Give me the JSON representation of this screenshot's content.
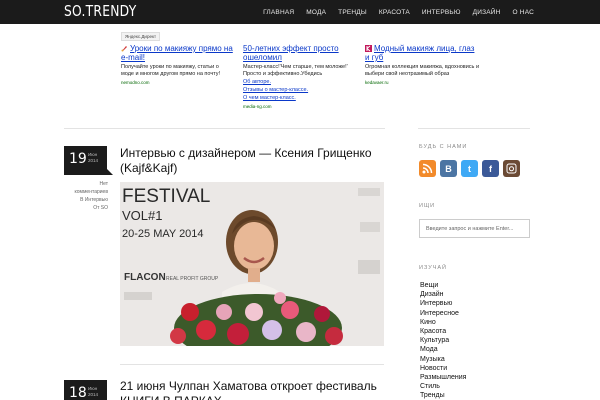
{
  "header": {
    "logo": "SO.TRENDY",
    "nav": [
      "ГЛАВНАЯ",
      "МОДА",
      "ТРЕНДЫ",
      "КРАСОТА",
      "ИНТЕРВЬЮ",
      "ДИЗАЙН",
      "О НАС"
    ]
  },
  "ads": {
    "label": "Яндекс.Директ",
    "items": [
      {
        "title": "Уроки по макияжу прямо на e-mail!",
        "text": "Получайте уроки по макияжу, статьи о моде и многом другом прямо на почту!",
        "domain": "nemodno.com",
        "links": []
      },
      {
        "title": "50-летних эффект просто ошеломил",
        "text": "Мастер-класс!'Чем старше, тем моложе!' Просто и эффективно.Убедись",
        "domain": "media-ng.com",
        "links": [
          "Об авторе.",
          "Отзывы о мастер-классе.",
          "О чем мастер-класс."
        ]
      },
      {
        "title": "Модный макияж лица, глаз и губ",
        "text": "Огромная коллекция макияжа, вдохновись и выбери свой неотразимый образ",
        "domain": "kedavaer.ru",
        "links": []
      }
    ]
  },
  "posts": [
    {
      "day": "19",
      "month": "Июн",
      "year": "2014",
      "meta": [
        "Нет",
        "комментариев",
        "В Интервью",
        "От SO"
      ],
      "title": "Интервью с дизайнером — Ксения Грищенко (Kajf&Kajf)",
      "image": {
        "festival_title": "FESTIVAL",
        "festival_sub": "VOL#1",
        "festival_dates": "20-25 MAY 2014",
        "sponsor": "FLACON",
        "sponsor2": "REAL PROFIT GROUP"
      }
    },
    {
      "day": "18",
      "month": "Июн",
      "year": "2014",
      "title": "21 июня Чулпан Хаматова откроет фестиваль КНИГИ В ПАРКАХ"
    }
  ],
  "sidebar": {
    "follow_heading": "БУДЬ С НАМИ",
    "search_heading": "ИЩИ",
    "search_placeholder": "Введите запрос и нажмите Enter...",
    "categories_heading": "ИЗУЧАЙ",
    "categories": [
      "Вещи",
      "Дизайн",
      "Интервью",
      "Интересное",
      "Кино",
      "Красота",
      "Культура",
      "Мода",
      "Музыка",
      "Новости",
      "Размышления",
      "Стиль",
      "Тренды"
    ]
  },
  "colors": {
    "topbar": "#1b1b1b",
    "ad_link": "#0a38c9",
    "rss": "#f28a2a",
    "vk": "#4c75a3",
    "twitter": "#3fa9f5",
    "facebook": "#3b5998",
    "instagram": "#6b4a34"
  }
}
